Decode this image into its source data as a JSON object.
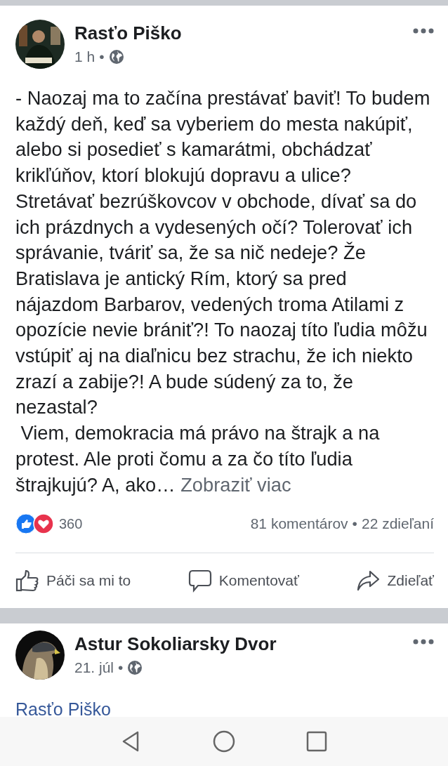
{
  "posts": [
    {
      "author": "Rasťo Piško",
      "time": "1 h",
      "separator": "•",
      "text": "- Naozaj ma to začína prestávať baviť! To budem každý deň, keď sa vyberiem do mesta nakúpiť, alebo si posedieť s kamarátmi, obchádzať krikľúňov, ktorí blokujú dopravu a ulice? Stretávať bezrúškovcov v obchode, dívať sa do ich prázdnych a vydesených očí? Tolerovať ich správanie, tváriť sa, že sa nič nedeje? Že Bratislava je antický Rím, ktorý sa pred nájazdom Barbarov, vedených troma Atilami z opozície nevie brániť?! To naozaj títo ľudia môžu vstúpiť aj na diaľnicu bez strachu, že ich niekto zrazí a zabije?! A bude súdený za to, že nezastal?\n Viem, demokracia má právo na štrajk a na protest. Ale proti čomu a za čo títo ľudia štrajkujú? A, ako…",
      "more": "Zobraziť viac",
      "reactions": "360",
      "comments": "81 komentárov",
      "stats_separator": "•",
      "shares": "22 zdieľaní",
      "actions": [
        {
          "kind": "like",
          "label": "Páči sa mi to"
        },
        {
          "kind": "comment",
          "label": "Komentovať"
        },
        {
          "kind": "share",
          "label": "Zdieľať"
        }
      ]
    },
    {
      "author": "Astur Sokoliarsky Dvor",
      "time": "21. júl",
      "separator": "•",
      "link": "Rasťo Piško"
    }
  ]
}
